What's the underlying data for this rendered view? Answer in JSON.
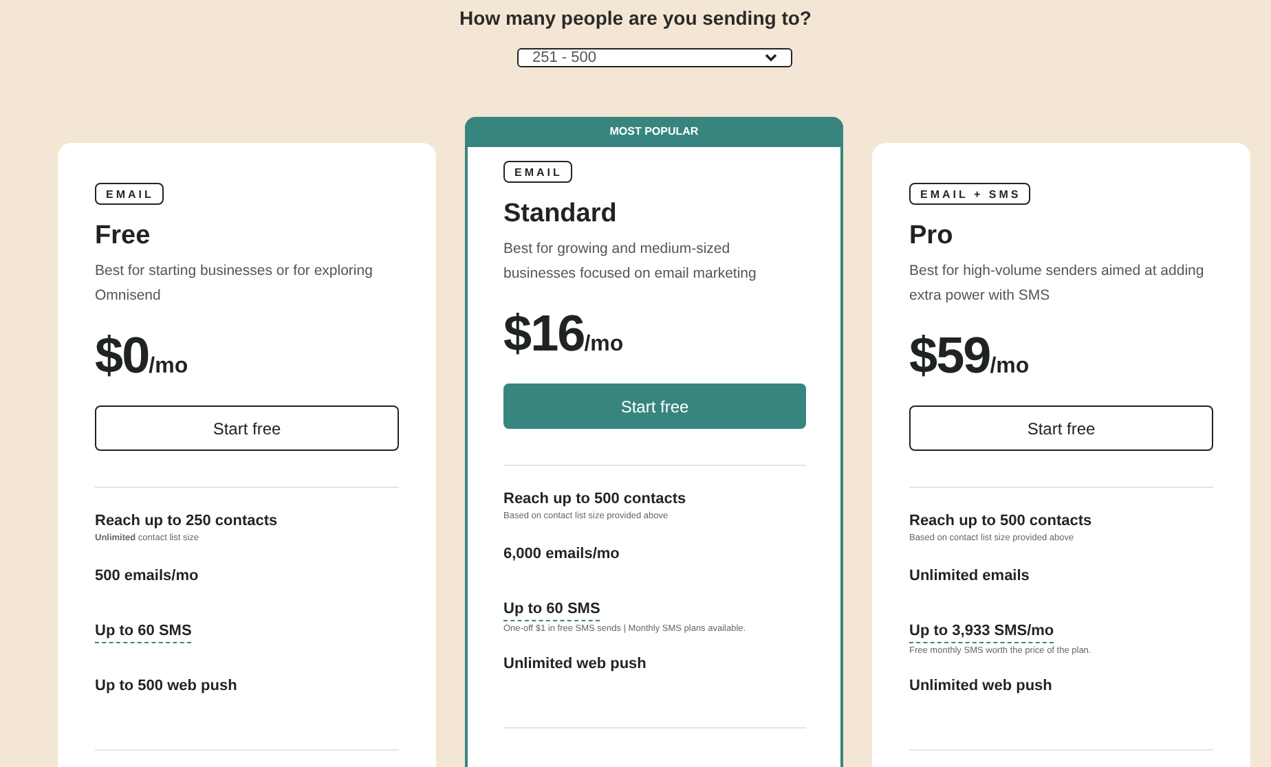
{
  "question": "How many people are you sending to?",
  "audience_select": {
    "value": "251 - 500"
  },
  "plans": [
    {
      "highlighted": false,
      "tag": "EMAIL",
      "name": "Free",
      "description": "Best for starting businesses or for exploring Omnisend",
      "price": "$0",
      "period": "/mo",
      "button": "Start free",
      "features": [
        {
          "kind": "plain",
          "title": "Reach up to 250 contacts",
          "note": "**Unlimited** contact list size"
        },
        {
          "kind": "plain",
          "title": "500 emails/mo"
        },
        {
          "kind": "sms",
          "title": "Up to 60 SMS"
        },
        {
          "kind": "plain",
          "title": "Up to 500 web push"
        }
      ]
    },
    {
      "highlighted": true,
      "banner": "MOST POPULAR",
      "tag": "EMAIL",
      "name": "Standard",
      "description": "Best for growing and medium-sized businesses focused on email marketing",
      "price": "$16",
      "period": "/mo",
      "button": "Start free",
      "features": [
        {
          "kind": "plain",
          "title": "Reach up to 500 contacts",
          "note": "Based on contact list size provided above"
        },
        {
          "kind": "plain",
          "title": "6,000 emails/mo"
        },
        {
          "kind": "sms",
          "title": "Up to 60 SMS",
          "note": "One-off $1 in free SMS sends | Monthly SMS plans available."
        },
        {
          "kind": "plain",
          "title": "Unlimited web push"
        }
      ]
    },
    {
      "highlighted": false,
      "tag": "EMAIL + SMS",
      "name": "Pro",
      "description": "Best for high-volume senders aimed at adding extra power with SMS",
      "price": "$59",
      "period": "/mo",
      "button": "Start free",
      "features": [
        {
          "kind": "plain",
          "title": "Reach up to 500 contacts",
          "note": "Based on contact list size provided above"
        },
        {
          "kind": "plain",
          "title": "Unlimited emails"
        },
        {
          "kind": "sms",
          "title": "Up to 3,933 SMS/mo",
          "note": "Free monthly SMS worth the price of the plan."
        },
        {
          "kind": "plain",
          "title": "Unlimited web push"
        }
      ]
    }
  ]
}
